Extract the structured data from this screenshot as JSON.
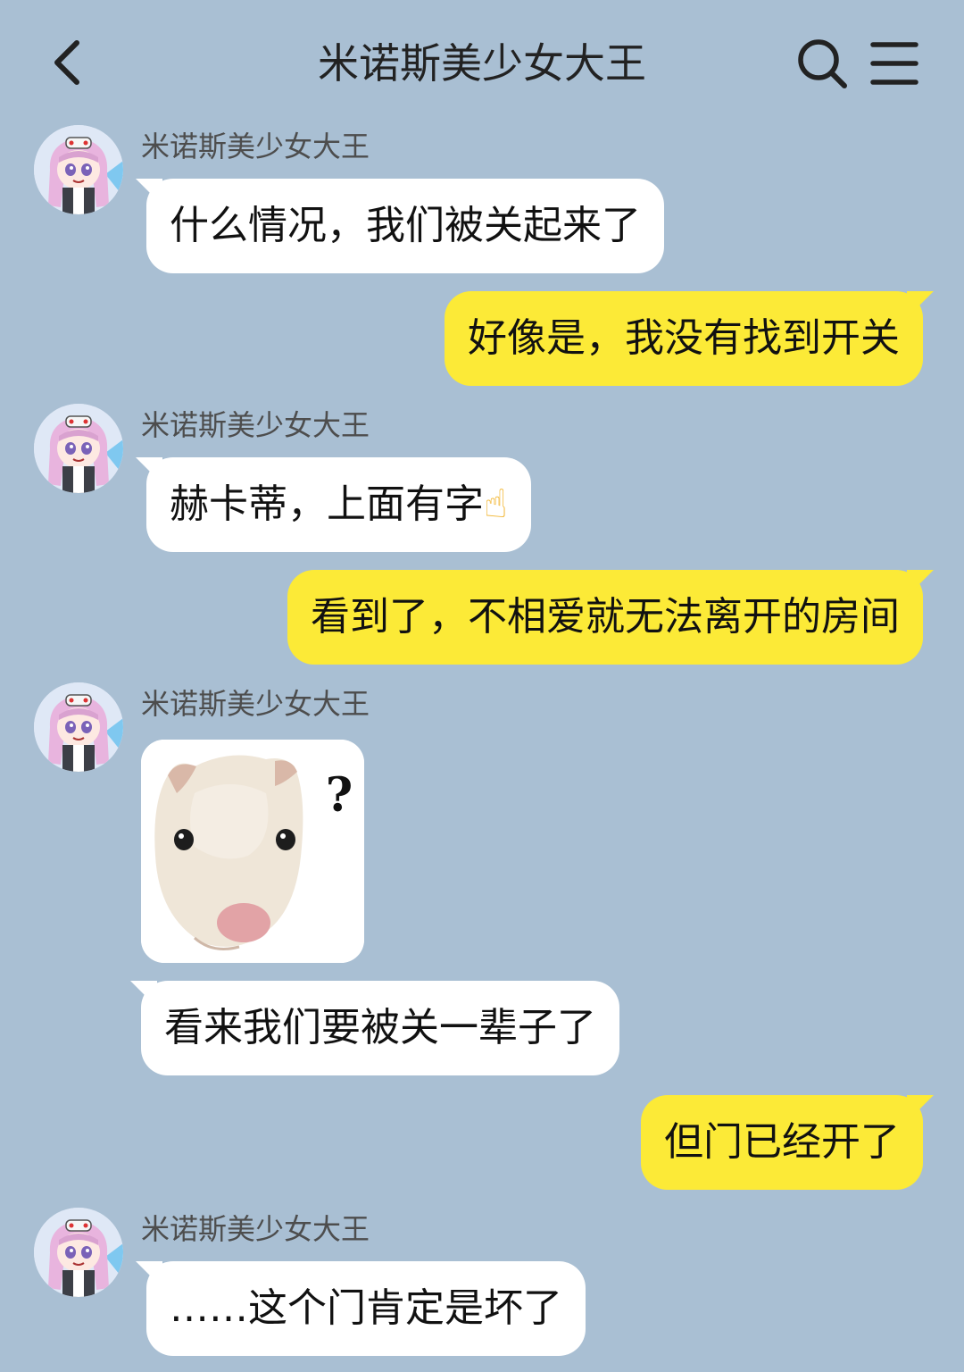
{
  "header": {
    "title": "米诺斯美少女大王",
    "back_icon": "chevron-left-icon",
    "search_icon": "search-icon",
    "menu_icon": "hamburger-menu-icon"
  },
  "colors": {
    "background": "#a9bfd3",
    "incoming_bubble": "#ffffff",
    "outgoing_bubble": "#fcea37"
  },
  "messages": [
    {
      "side": "in",
      "sender": "米诺斯美少女大王",
      "text": "什么情况，我们被关起来了"
    },
    {
      "side": "out",
      "text": "好像是，我没有找到开关"
    },
    {
      "side": "in",
      "sender": "米诺斯美少女大王",
      "text": "赫卡蒂，上面有字",
      "emoji": "☝"
    },
    {
      "side": "out",
      "text": "看到了，不相爱就无法离开的房间"
    },
    {
      "side": "in",
      "sender": "米诺斯美少女大王",
      "sticker": "hamster-question-sticker",
      "sticker_text": "?"
    },
    {
      "side": "in",
      "text": "看来我们要被关一辈子了"
    },
    {
      "side": "out",
      "text": "但门已经开了"
    },
    {
      "side": "in",
      "sender": "米诺斯美少女大王",
      "text": "……这个门肯定是坏了"
    }
  ]
}
